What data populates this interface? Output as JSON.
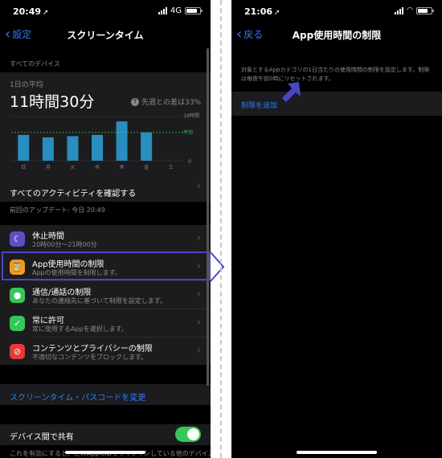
{
  "left": {
    "status": {
      "time": "20:49",
      "network": "4G"
    },
    "nav": {
      "back_label": "設定",
      "title": "スクリーンタイム"
    },
    "section_all_devices": "すべてのデバイス",
    "summary": {
      "avg_label": "1日の平均",
      "avg_value": "11時間30分",
      "diff_label": "先週との差は33%",
      "y_max_label": "18時間",
      "avg_line_label": "平均",
      "zero_label": "0"
    },
    "chart_data": {
      "type": "bar",
      "categories": [
        "日",
        "月",
        "火",
        "水",
        "木",
        "金",
        "土"
      ],
      "values": [
        10.5,
        9.5,
        10,
        10.5,
        16,
        11.5,
        0
      ],
      "ylim": [
        0,
        18
      ],
      "average": 11.5,
      "bar_color": "#2a8dc0"
    },
    "all_activity_label": "すべてのアクティビティを確認する",
    "updated_label": "前回のアップデート: 今日 20:49",
    "features": [
      {
        "title": "休止時間",
        "subtitle": "20時00分～21時00分",
        "icon": "moon-icon",
        "color": "#5b4fc8"
      },
      {
        "title": "App使用時間の制限",
        "subtitle": "Appの使用時間を制限します。",
        "icon": "hourglass-icon",
        "color": "#f29b21"
      },
      {
        "title": "通信/通話の制限",
        "subtitle": "あなたの連絡先に基づいて制限を設定します。",
        "icon": "person-icon",
        "color": "#34c759"
      },
      {
        "title": "常に許可",
        "subtitle": "常に使用するAppを選択します。",
        "icon": "checkmark-icon",
        "color": "#34c759"
      },
      {
        "title": "コンテンツとプライバシーの制限",
        "subtitle": "不適切なコンテンツをブロックします。",
        "icon": "block-icon",
        "color": "#e5393a"
      }
    ],
    "passcode_link": "スクリーンタイム・パスコードを変更",
    "share_label": "デバイス間で共有",
    "share_enabled": true,
    "footer_text": "これを有効にすると、このAppleIDでサインインしている他のデバイスすべての画面"
  },
  "right": {
    "status": {
      "time": "21:06"
    },
    "nav": {
      "back_label": "戻る",
      "title": "App使用時間の制限"
    },
    "description": "対象とするAppカテゴリの1日当たりの使用時間の制限を設定します。制限は毎夜午前0時にリセットされます。",
    "add_limit_label": "制限を追加"
  },
  "colors": {
    "accent": "#2f7cf6",
    "highlight": "#4b45c7",
    "toggle_on": "#34c759"
  }
}
